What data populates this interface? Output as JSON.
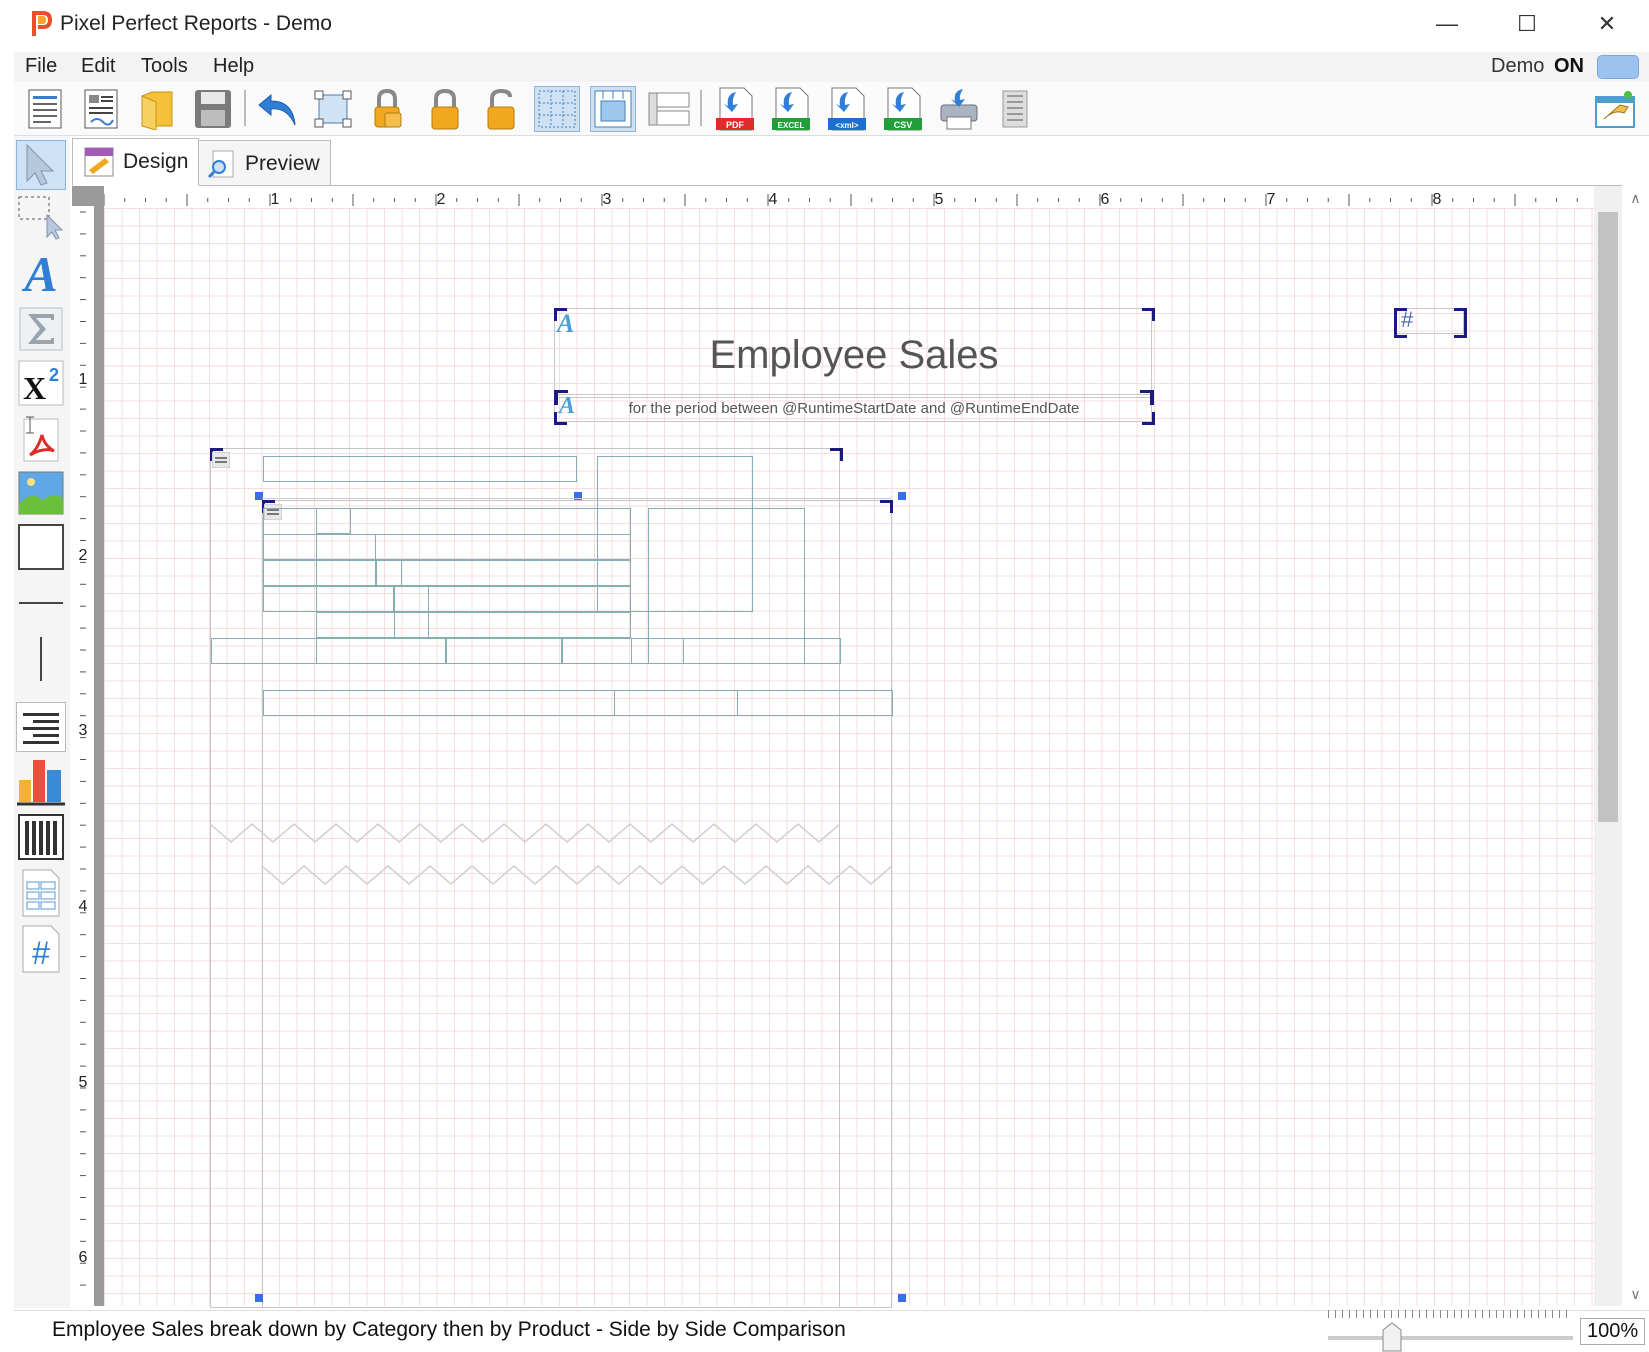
{
  "window": {
    "title": "Pixel Perfect Reports - Demo",
    "controls": {
      "minimize": "—",
      "maximize": "☐",
      "close": "✕"
    }
  },
  "menu": {
    "items": [
      "File",
      "Edit",
      "Tools",
      "Help"
    ],
    "demo_label": "Demo",
    "demo_state": "ON"
  },
  "toolbar": {
    "buttons": [
      "new-report-icon",
      "report-wizard-icon",
      "open-folder-icon",
      "save-icon",
      "undo-icon",
      "resize-icon",
      "lock-all-icon",
      "lock-icon",
      "unlock-icon",
      "grid-icon",
      "snap-grid-icon",
      "bands-icon",
      "export-pdf-icon",
      "export-excel-icon",
      "export-xml-icon",
      "export-csv-icon",
      "print-icon",
      "print-preview-icon",
      "settings-icon"
    ],
    "export_badges": {
      "pdf": "PDF",
      "excel": "EXCEL",
      "xml": "<xml>",
      "csv": "CSV"
    }
  },
  "tabs": {
    "design": "Design",
    "preview": "Preview"
  },
  "palette": {
    "tools": [
      "pointer-icon",
      "marquee-select-icon",
      "text-icon",
      "sum-icon",
      "superscript-icon",
      "pdf-field-icon",
      "image-icon",
      "rectangle-icon",
      "horizontal-line-icon",
      "vertical-line-icon",
      "rich-text-icon",
      "chart-icon",
      "table-icon",
      "sub-report-icon",
      "page-number-icon"
    ],
    "superscript_text": "X",
    "superscript_exp": "2",
    "page_number_text": "#",
    "text_glyph": "A"
  },
  "ruler": {
    "top_numbers": [
      "1",
      "2",
      "3",
      "4",
      "5",
      "6",
      "7",
      "8"
    ],
    "left_numbers": [
      "1",
      "2",
      "3",
      "4",
      "5",
      "6"
    ]
  },
  "report": {
    "title": "Employee Sales",
    "subtitle": "for the period between @RuntimeStartDate and @RuntimeEndDate",
    "page_number_glyph": "#",
    "text_marker": "A"
  },
  "status": {
    "description": "Employee Sales break down by Category then by Product - Side by Side Comparison",
    "zoom": "100%"
  },
  "colors": {
    "accent": "#3a6ee8",
    "handle_border": "#1a1a80",
    "box_border": "#87aeb3",
    "grid": "#f4dede"
  }
}
